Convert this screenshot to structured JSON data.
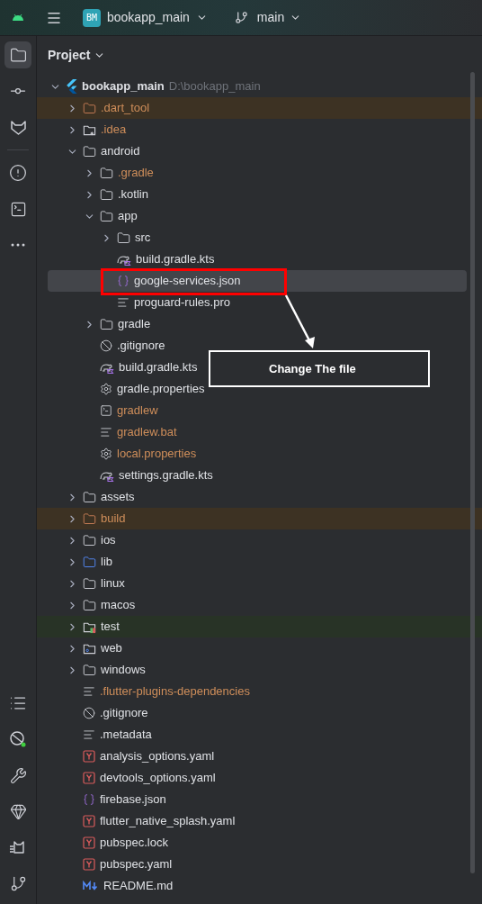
{
  "toolbar": {
    "project_badge": "BM",
    "project": "bookapp_main",
    "branch": "main"
  },
  "panel": {
    "title": "Project"
  },
  "tree": {
    "name": "bookapp_main",
    "path": "D:\\bookapp_main",
    "kind": "flutter",
    "expanded": true,
    "selected": false,
    "children": [
      {
        "name": ".dart_tool",
        "kind": "folder-excluded",
        "ignored": true,
        "expanded": false,
        "selected": false
      },
      {
        "name": ".idea",
        "kind": "folder-config",
        "ignored": true,
        "expanded": false,
        "selected": false
      },
      {
        "name": "android",
        "kind": "folder",
        "ignored": false,
        "expanded": true,
        "selected": false,
        "children": [
          {
            "name": ".gradle",
            "kind": "folder",
            "ignored": true,
            "expanded": false,
            "selected": false
          },
          {
            "name": ".kotlin",
            "kind": "folder",
            "ignored": false,
            "expanded": false,
            "selected": false
          },
          {
            "name": "app",
            "kind": "folder",
            "ignored": false,
            "expanded": true,
            "selected": false,
            "children": [
              {
                "name": "src",
                "kind": "folder",
                "ignored": false,
                "expanded": false,
                "selected": false
              },
              {
                "name": "build.gradle.kts",
                "kind": "gradle",
                "ignored": false,
                "selected": false
              },
              {
                "name": "google-services.json",
                "kind": "json",
                "ignored": false,
                "selected": true
              },
              {
                "name": "proguard-rules.pro",
                "kind": "text",
                "ignored": false,
                "selected": false
              }
            ]
          },
          {
            "name": "gradle",
            "kind": "folder",
            "ignored": false,
            "expanded": false,
            "selected": false
          },
          {
            "name": ".gitignore",
            "kind": "ignore",
            "ignored": false,
            "selected": false
          },
          {
            "name": "build.gradle.kts",
            "kind": "gradle",
            "ignored": false,
            "selected": false
          },
          {
            "name": "gradle.properties",
            "kind": "settings",
            "ignored": false,
            "selected": false
          },
          {
            "name": "gradlew",
            "kind": "script",
            "ignored": true,
            "selected": false
          },
          {
            "name": "gradlew.bat",
            "kind": "text",
            "ignored": true,
            "selected": false
          },
          {
            "name": "local.properties",
            "kind": "settings",
            "ignored": true,
            "selected": false
          },
          {
            "name": "settings.gradle.kts",
            "kind": "gradle",
            "ignored": false,
            "selected": false
          }
        ]
      },
      {
        "name": "assets",
        "kind": "folder",
        "ignored": false,
        "expanded": false,
        "selected": false
      },
      {
        "name": "build",
        "kind": "folder-excluded",
        "ignored": true,
        "expanded": false,
        "selected": false
      },
      {
        "name": "ios",
        "kind": "folder",
        "ignored": false,
        "expanded": false,
        "selected": false
      },
      {
        "name": "lib",
        "kind": "folder-source",
        "ignored": false,
        "expanded": false,
        "selected": false
      },
      {
        "name": "linux",
        "kind": "folder",
        "ignored": false,
        "expanded": false,
        "selected": false
      },
      {
        "name": "macos",
        "kind": "folder",
        "ignored": false,
        "expanded": false,
        "selected": false
      },
      {
        "name": "test",
        "kind": "folder-test",
        "ignored": false,
        "expanded": false,
        "selected": false
      },
      {
        "name": "web",
        "kind": "folder-web",
        "ignored": false,
        "expanded": false,
        "selected": false
      },
      {
        "name": "windows",
        "kind": "folder",
        "ignored": false,
        "expanded": false,
        "selected": false
      },
      {
        "name": ".flutter-plugins-dependencies",
        "kind": "text",
        "ignored": true,
        "selected": false
      },
      {
        "name": ".gitignore",
        "kind": "ignore",
        "ignored": false,
        "selected": false
      },
      {
        "name": ".metadata",
        "kind": "text",
        "ignored": false,
        "selected": false
      },
      {
        "name": "analysis_options.yaml",
        "kind": "yaml",
        "ignored": false,
        "selected": false
      },
      {
        "name": "devtools_options.yaml",
        "kind": "yaml",
        "ignored": false,
        "selected": false
      },
      {
        "name": "firebase.json",
        "kind": "json",
        "ignored": false,
        "selected": false
      },
      {
        "name": "flutter_native_splash.yaml",
        "kind": "yaml",
        "ignored": false,
        "selected": false
      },
      {
        "name": "pubspec.lock",
        "kind": "yaml",
        "ignored": false,
        "selected": false
      },
      {
        "name": "pubspec.yaml",
        "kind": "yaml",
        "ignored": false,
        "selected": false
      },
      {
        "name": "README.md",
        "kind": "markdown",
        "ignored": false,
        "selected": false
      }
    ]
  },
  "annotation": {
    "text": "Change The file"
  }
}
